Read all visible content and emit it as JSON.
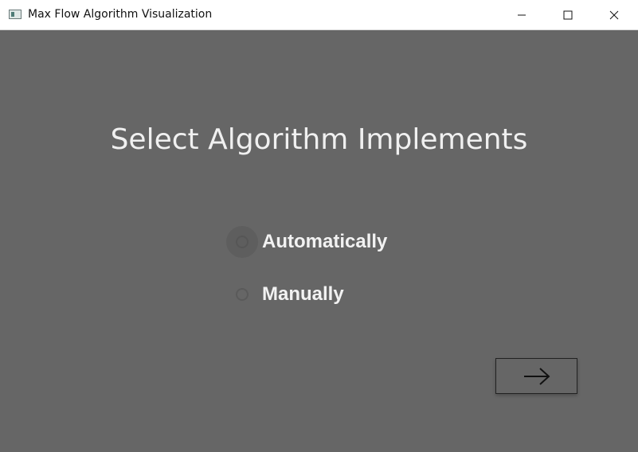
{
  "window": {
    "title": "Max Flow Algorithm Visualization",
    "controls": [
      "minimize-icon",
      "maximize-icon",
      "close-icon"
    ]
  },
  "main": {
    "heading": "Select Algorithm Implements",
    "options": [
      {
        "label": "Automatically",
        "selected": false
      },
      {
        "label": "Manually",
        "selected": false
      }
    ],
    "next_button_icon": "arrow-right-icon"
  },
  "colors": {
    "background": "#666666",
    "titlebar": "#ffffff",
    "text": "#f0f0f0"
  }
}
